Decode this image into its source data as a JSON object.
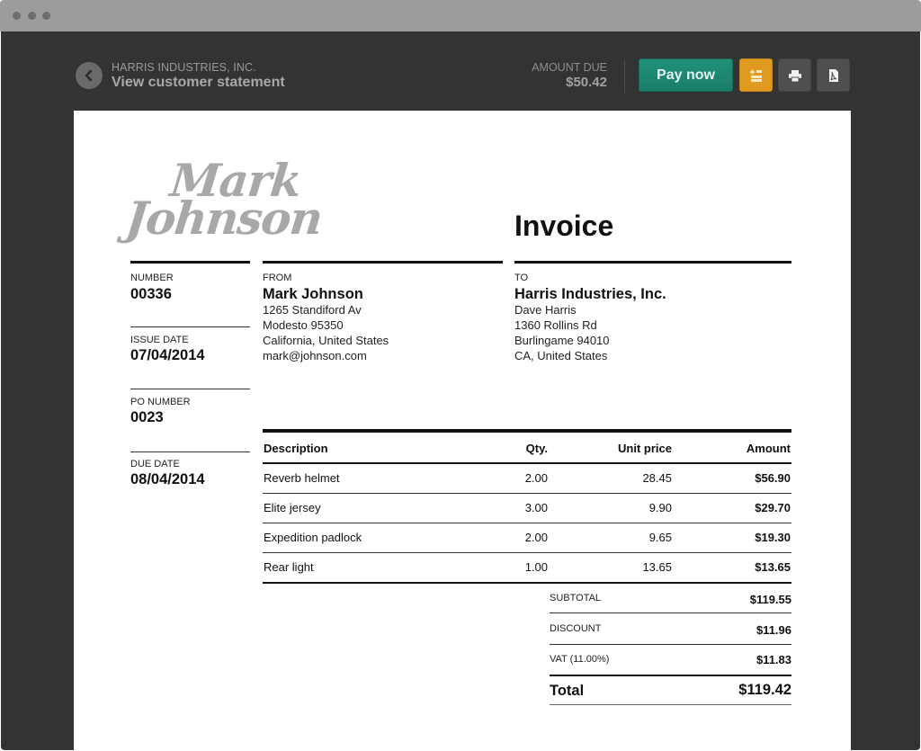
{
  "header": {
    "company": "HARRIS INDUSTRIES, INC.",
    "title": "View customer statement",
    "amount_due_label": "AMOUNT DUE",
    "amount_due_value": "$50.42",
    "pay_button": "Pay now",
    "icons": {
      "back": "chevron-left-icon",
      "add": "add-list-icon",
      "print": "printer-icon",
      "pdf": "pdf-icon"
    },
    "colors": {
      "pay": "#1f8a73",
      "add": "#e09a1f",
      "icon_button": "#4f4f4f",
      "background": "#333333"
    }
  },
  "invoice": {
    "logo_line1": "Mark",
    "logo_line2": "Johnson",
    "title": "Invoice",
    "meta": [
      {
        "label": "NUMBER",
        "value": "00336"
      },
      {
        "label": "ISSUE DATE",
        "value": "07/04/2014"
      },
      {
        "label": "PO NUMBER",
        "value": "0023"
      },
      {
        "label": "DUE DATE",
        "value": "08/04/2014"
      }
    ],
    "from": {
      "label": "FROM",
      "name": "Mark Johnson",
      "lines": [
        "1265 Standiford Av",
        "Modesto 95350",
        "California, United States",
        "mark@johnson.com"
      ]
    },
    "to": {
      "label": "TO",
      "name": "Harris Industries, Inc.",
      "lines": [
        "Dave Harris",
        "1360 Rollins Rd",
        "Burlingame 94010",
        "CA, United States"
      ]
    },
    "table": {
      "headers": {
        "description": "Description",
        "qty": "Qty.",
        "unit_price": "Unit price",
        "amount": "Amount"
      },
      "rows": [
        {
          "description": "Reverb helmet",
          "qty": "2.00",
          "unit_price": "28.45",
          "amount": "$56.90"
        },
        {
          "description": "Elite jersey",
          "qty": "3.00",
          "unit_price": "9.90",
          "amount": "$29.70"
        },
        {
          "description": "Expedition padlock",
          "qty": "2.00",
          "unit_price": "9.65",
          "amount": "$19.30"
        },
        {
          "description": "Rear light",
          "qty": "1.00",
          "unit_price": "13.65",
          "amount": "$13.65"
        }
      ]
    },
    "summary": {
      "subtotal_label": "SUBTOTAL",
      "subtotal_value": "$119.55",
      "discount_label": "DISCOUNT",
      "discount_value": "$11.96",
      "vat_label": "VAT (11.00%)",
      "vat_value": "$11.83",
      "total_label": "Total",
      "total_value": "$119.42"
    }
  }
}
